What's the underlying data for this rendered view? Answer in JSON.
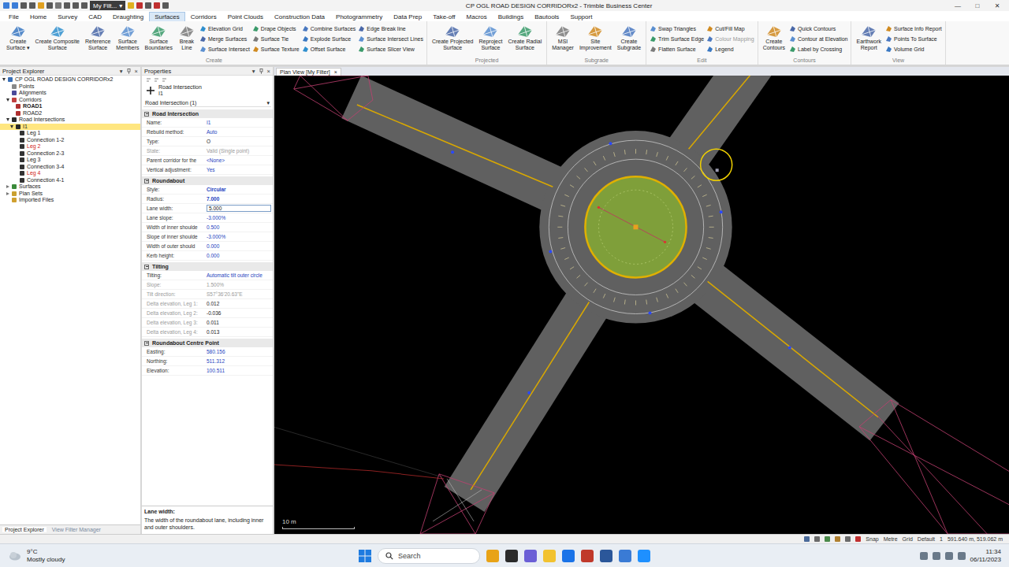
{
  "window": {
    "title": "CP OGL ROAD DESIGN CORRIDORx2 - Trimble Business Center",
    "filter": "My Filt...",
    "filter_arrow": "▾",
    "controls": [
      "—",
      "□",
      "✕"
    ]
  },
  "menu": [
    {
      "label": "File",
      "selected": false
    },
    {
      "label": "Home",
      "selected": false
    },
    {
      "label": "Survey",
      "selected": false
    },
    {
      "label": "CAD",
      "selected": false
    },
    {
      "label": "Draughting",
      "selected": false
    },
    {
      "label": "Surfaces",
      "selected": true
    },
    {
      "label": "Corridors",
      "selected": false
    },
    {
      "label": "Point Clouds",
      "selected": false
    },
    {
      "label": "Construction Data",
      "selected": false
    },
    {
      "label": "Photogrammetry",
      "selected": false
    },
    {
      "label": "Data Prep",
      "selected": false
    },
    {
      "label": "Take-off",
      "selected": false
    },
    {
      "label": "Macros",
      "selected": false
    },
    {
      "label": "Buildings",
      "selected": false
    },
    {
      "label": "Bautools",
      "selected": false
    },
    {
      "label": "Support",
      "selected": false
    }
  ],
  "ribbon": {
    "groups": [
      {
        "label": "Create",
        "large": [
          {
            "lines": [
              "Create",
              "Surface"
            ],
            "arrow": "▾"
          },
          {
            "lines": [
              "Create Composite",
              "Surface"
            ]
          },
          {
            "lines": [
              "Reference",
              "Surface"
            ]
          },
          {
            "lines": [
              "Surface",
              "Members"
            ]
          },
          {
            "lines": [
              "Surface",
              "Boundaries"
            ]
          },
          {
            "lines": [
              "Break",
              "Line"
            ]
          }
        ],
        "small": [
          [
            {
              "label": "Elevation Grid",
              "disabled": false
            },
            {
              "label": "Merge Surfaces",
              "disabled": false
            },
            {
              "label": "Surface Intersect",
              "disabled": false
            }
          ],
          [
            {
              "label": "Drape Objects",
              "disabled": false
            },
            {
              "label": "Surface Tie",
              "disabled": false
            },
            {
              "label": "Surface Texture",
              "disabled": false
            }
          ],
          [
            {
              "label": "Combine Surfaces",
              "disabled": false
            },
            {
              "label": "Explode Surface",
              "disabled": false
            },
            {
              "label": "Offset Surface",
              "disabled": false
            }
          ],
          [
            {
              "label": "Edge Break line",
              "disabled": false
            },
            {
              "label": "Surface Intersect Lines",
              "disabled": false
            },
            {
              "label": "Surface Slicer View",
              "disabled": false
            }
          ]
        ]
      },
      {
        "label": "Projected",
        "large": [
          {
            "lines": [
              "Create Projected",
              "Surface"
            ]
          },
          {
            "lines": [
              "Reproject",
              "Surface"
            ]
          },
          {
            "lines": [
              "Create Radial",
              "Surface"
            ]
          }
        ],
        "small": []
      },
      {
        "label": "Subgrade",
        "large": [
          {
            "lines": [
              "MSI",
              "Manager"
            ]
          },
          {
            "lines": [
              "Site",
              "Improvement"
            ]
          },
          {
            "lines": [
              "Create",
              "Subgrade"
            ]
          }
        ],
        "small": []
      },
      {
        "label": "Edit",
        "large": [],
        "small": [
          [
            {
              "label": "Swap Triangles",
              "disabled": false
            },
            {
              "label": "Trim Surface Edge",
              "disabled": false
            },
            {
              "label": "Flatten Surface",
              "disabled": false
            }
          ],
          [
            {
              "label": "Cut/Fill Map",
              "disabled": false
            },
            {
              "label": "Colour Mapping",
              "disabled": true
            },
            {
              "label": "Legend",
              "disabled": false
            }
          ]
        ]
      },
      {
        "label": "Contours",
        "large": [
          {
            "lines": [
              "Create",
              "Contours"
            ]
          }
        ],
        "small": [
          [
            {
              "label": "Quick Contours",
              "disabled": false
            },
            {
              "label": "Contour at Elevation",
              "disabled": false
            },
            {
              "label": "Label by Crossing",
              "disabled": false
            }
          ]
        ]
      },
      {
        "label": "View",
        "large": [
          {
            "lines": [
              "Earthwork",
              "Report"
            ]
          }
        ],
        "small": [
          [
            {
              "label": "Surface Info Report",
              "disabled": false
            },
            {
              "label": "Points To Surface",
              "disabled": false
            },
            {
              "label": "Volume Grid",
              "disabled": false
            }
          ]
        ]
      }
    ]
  },
  "project_explorer": {
    "title": "Project Explorer",
    "controls": [
      "▾",
      "×"
    ],
    "items": [
      {
        "label": "CP OGL ROAD DESIGN CORRIDORx2",
        "level": 0,
        "kind": "project",
        "expandable": true,
        "expanded": true,
        "selected": false,
        "bold": false,
        "error": false
      },
      {
        "label": "Points",
        "level": 1,
        "kind": "points",
        "expandable": false,
        "expanded": false,
        "selected": false,
        "bold": false,
        "error": false
      },
      {
        "label": "Alignments",
        "level": 1,
        "kind": "alignment",
        "expandable": false,
        "expanded": false,
        "selected": false,
        "bold": false,
        "error": false
      },
      {
        "label": "Corridors",
        "level": 1,
        "kind": "corridor",
        "expandable": true,
        "expanded": true,
        "selected": false,
        "bold": false,
        "error": false
      },
      {
        "label": "ROAD1",
        "level": 2,
        "kind": "road",
        "expandable": false,
        "expanded": false,
        "selected": false,
        "bold": true,
        "error": false
      },
      {
        "label": "ROAD2",
        "level": 2,
        "kind": "road",
        "expandable": false,
        "expanded": false,
        "selected": false,
        "bold": false,
        "error": false
      },
      {
        "label": "Road Intersections",
        "level": 1,
        "kind": "intersections",
        "expandable": true,
        "expanded": true,
        "selected": false,
        "bold": false,
        "error": false
      },
      {
        "label": "I1",
        "level": 2,
        "kind": "intersection",
        "expandable": true,
        "expanded": true,
        "selected": true,
        "bold": false,
        "error": false
      },
      {
        "label": "Leg 1",
        "level": 3,
        "kind": "leg",
        "expandable": false,
        "expanded": false,
        "selected": false,
        "bold": false,
        "error": false
      },
      {
        "label": "Connection 1-2",
        "level": 3,
        "kind": "leg",
        "expandable": false,
        "expanded": false,
        "selected": false,
        "bold": false,
        "error": false
      },
      {
        "label": "Leg 2",
        "level": 3,
        "kind": "leg",
        "expandable": false,
        "expanded": false,
        "selected": false,
        "bold": false,
        "error": true
      },
      {
        "label": "Connection 2-3",
        "level": 3,
        "kind": "leg",
        "expandable": false,
        "expanded": false,
        "selected": false,
        "bold": false,
        "error": false
      },
      {
        "label": "Leg 3",
        "level": 3,
        "kind": "leg",
        "expandable": false,
        "expanded": false,
        "selected": false,
        "bold": false,
        "error": false
      },
      {
        "label": "Connection 3-4",
        "level": 3,
        "kind": "leg",
        "expandable": false,
        "expanded": false,
        "selected": false,
        "bold": false,
        "error": false
      },
      {
        "label": "Leg 4",
        "level": 3,
        "kind": "leg",
        "expandable": false,
        "expanded": false,
        "selected": false,
        "bold": false,
        "error": true
      },
      {
        "label": "Connection 4-1",
        "level": 3,
        "kind": "leg",
        "expandable": false,
        "expanded": false,
        "selected": false,
        "bold": false,
        "error": false
      },
      {
        "label": "Surfaces",
        "level": 1,
        "kind": "surfaces",
        "expandable": true,
        "expanded": false,
        "selected": false,
        "bold": false,
        "error": false
      },
      {
        "label": "Plan Sets",
        "level": 1,
        "kind": "plansets",
        "expandable": true,
        "expanded": false,
        "selected": false,
        "bold": false,
        "error": false
      },
      {
        "label": "Imported Files",
        "level": 1,
        "kind": "files",
        "expandable": false,
        "expanded": false,
        "selected": false,
        "bold": false,
        "error": false
      }
    ],
    "tabs": [
      {
        "label": "Project Explorer",
        "selected": true
      },
      {
        "label": "View Filter Manager",
        "selected": false
      }
    ]
  },
  "properties": {
    "title": "Properties",
    "controls": [
      "▾",
      "×"
    ],
    "object_title": "Road Intersection",
    "object_name": "I1",
    "selector": "Road Intersection (1)",
    "selector_arrow": "▾",
    "sections": [
      {
        "title": "Road Intersection",
        "expanded": true,
        "rows": [
          {
            "label": "Name:",
            "value": "I1",
            "label_greyed": false,
            "value_style": "link",
            "modified": false
          },
          {
            "label": "Rebuild method:",
            "value": "Auto",
            "label_greyed": false,
            "value_style": "link",
            "modified": false
          },
          {
            "label": "Type:",
            "value": "O",
            "label_greyed": false,
            "value_style": "plain",
            "modified": false
          },
          {
            "label": "State:",
            "value": "Valid (Single point)",
            "label_greyed": true,
            "value_style": "grey",
            "modified": false
          },
          {
            "label": "Parent corridor for the",
            "value": "<None>",
            "label_greyed": false,
            "value_style": "link",
            "modified": false
          },
          {
            "label": "Vertical adjustment:",
            "value": "Yes",
            "label_greyed": false,
            "value_style": "link",
            "modified": false
          }
        ]
      },
      {
        "title": "Roundabout",
        "expanded": true,
        "rows": [
          {
            "label": "Style:",
            "value": "Circular",
            "label_greyed": false,
            "value_style": "link",
            "modified": true
          },
          {
            "label": "Radius:",
            "value": "7.000",
            "label_greyed": false,
            "value_style": "link",
            "modified": true
          },
          {
            "label": "Lane width:",
            "value": "5.000",
            "label_greyed": false,
            "value_style": "edit",
            "modified": false
          },
          {
            "label": "Lane slope:",
            "value": "-3.000%",
            "label_greyed": false,
            "value_style": "link",
            "modified": false
          },
          {
            "label": "Width of inner shoulde",
            "value": "0.500",
            "label_greyed": false,
            "value_style": "link",
            "modified": false
          },
          {
            "label": "Slope of inner shoulde",
            "value": "-3.000%",
            "label_greyed": false,
            "value_style": "link",
            "modified": false
          },
          {
            "label": "Width of outer should",
            "value": "0.000",
            "label_greyed": false,
            "value_style": "link",
            "modified": false
          },
          {
            "label": "Kerb height:",
            "value": "0.000",
            "label_greyed": false,
            "value_style": "link",
            "modified": false
          }
        ]
      },
      {
        "title": "Tilting",
        "expanded": true,
        "rows": [
          {
            "label": "Tilting:",
            "value": "Automatic tilt outer circle",
            "label_greyed": false,
            "value_style": "link",
            "modified": false
          },
          {
            "label": "Slope:",
            "value": "1.500%",
            "label_greyed": true,
            "value_style": "grey",
            "modified": false
          },
          {
            "label": "Tilt direction:",
            "value": "S57°36'20.63\"E",
            "label_greyed": true,
            "value_style": "grey",
            "modified": false
          },
          {
            "label": "Delta elevation, Leg 1:",
            "value": "0.012",
            "label_greyed": true,
            "value_style": "plain",
            "modified": false
          },
          {
            "label": "Delta elevation, Leg 2:",
            "value": "-0.036",
            "label_greyed": true,
            "value_style": "plain",
            "modified": false
          },
          {
            "label": "Delta elevation, Leg 3:",
            "value": "0.011",
            "label_greyed": true,
            "value_style": "plain",
            "modified": false
          },
          {
            "label": "Delta elevation, Leg 4:",
            "value": "0.013",
            "label_greyed": true,
            "value_style": "plain",
            "modified": false
          }
        ]
      },
      {
        "title": "Roundabout Centre Point",
        "expanded": true,
        "rows": [
          {
            "label": "Easting:",
            "value": "580.156",
            "label_greyed": false,
            "value_style": "link",
            "modified": false
          },
          {
            "label": "Northing:",
            "value": "511.312",
            "label_greyed": false,
            "value_style": "link",
            "modified": false
          },
          {
            "label": "Elevation:",
            "value": "100.511",
            "label_greyed": false,
            "value_style": "link",
            "modified": false
          }
        ]
      }
    ],
    "help": {
      "title": "Lane width:",
      "text": "The width of the roundabout lane, including inner and outer shoulders."
    }
  },
  "plan_view": {
    "tab": "Plan View [My Filter]",
    "close": "×",
    "scale": "10 m"
  },
  "status_bar": {
    "items": [
      "Snap",
      "Metre",
      "Grid",
      "Default",
      "1"
    ],
    "coords": "591.640 m, 519.062 m"
  },
  "taskbar": {
    "temperature": "9°C",
    "weather": "Mostly cloudy",
    "search": "Search",
    "time": "11:34",
    "date": "06/11/2023"
  }
}
